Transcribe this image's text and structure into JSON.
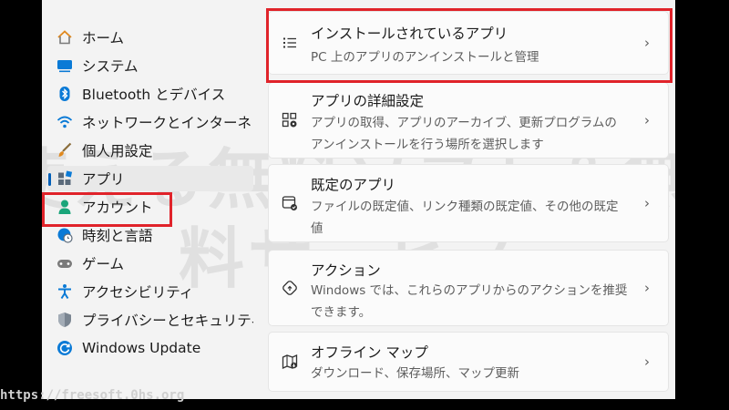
{
  "sidebar": {
    "items": [
      {
        "label": "ホーム",
        "icon": "home-icon"
      },
      {
        "label": "システム",
        "icon": "system-icon"
      },
      {
        "label": "Bluetooth とデバイス",
        "icon": "bluetooth-icon"
      },
      {
        "label": "ネットワークとインターネッ",
        "icon": "wifi-icon"
      },
      {
        "label": "個人用設定",
        "icon": "brush-icon"
      },
      {
        "label": "アプリ",
        "icon": "apps-icon"
      },
      {
        "label": "アカウント",
        "icon": "account-icon"
      },
      {
        "label": "時刻と言語",
        "icon": "globe-clock-icon"
      },
      {
        "label": "ゲーム",
        "icon": "gamepad-icon"
      },
      {
        "label": "アクセシビリティ",
        "icon": "accessibility-icon"
      },
      {
        "label": "プライバシーとセキュリティ",
        "icon": "shield-icon"
      },
      {
        "label": "Windows Update",
        "icon": "update-icon"
      }
    ]
  },
  "cards": [
    {
      "title": "インストールされているアプリ",
      "desc": "PC 上のアプリのアンインストールと管理",
      "icon": "list-icon"
    },
    {
      "title": "アプリの詳細設定",
      "desc": "アプリの取得、アプリのアーカイブ、更新プログラムのアンインストールを行う場所を選択します",
      "icon": "app-settings-icon"
    },
    {
      "title": "既定のアプリ",
      "desc": "ファイルの既定値、リンク種類の既定値、その他の既定値",
      "icon": "default-apps-icon"
    },
    {
      "title": "アクション",
      "desc": "Windows では、これらのアプリからのアクションを推奨できます。",
      "icon": "action-icon"
    },
    {
      "title": "オフライン マップ",
      "desc": "ダウンロード、保存場所、マップ更新",
      "icon": "map-icon"
    }
  ],
  "chevron": "›",
  "watermark": {
    "line1": "使える無料ソフト＆無",
    "line2": "料サービス"
  },
  "url": "https://freesoft.0hs.org",
  "colors": {
    "highlight": "#e0232a",
    "accent": "#005fb8"
  }
}
